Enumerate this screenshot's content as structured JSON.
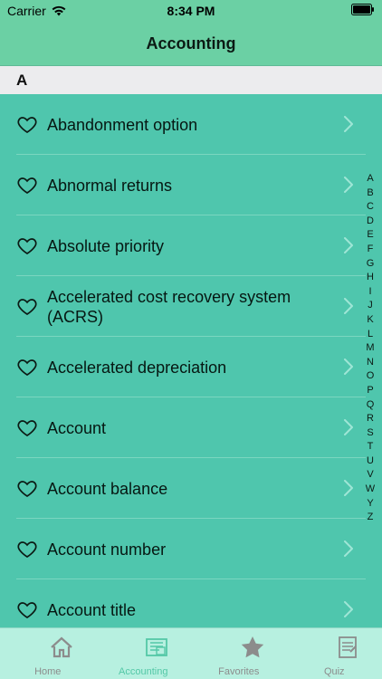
{
  "status": {
    "carrier": "Carrier",
    "time": "8:34 PM"
  },
  "nav": {
    "title": "Accounting"
  },
  "section": {
    "letter": "A"
  },
  "terms": [
    "Abandonment option",
    "Abnormal returns",
    "Absolute priority",
    "Accelerated cost recovery system (ACRS)",
    "Accelerated depreciation",
    "Account",
    "Account balance",
    "Account number",
    "Account title"
  ],
  "index_letters": [
    "A",
    "B",
    "C",
    "D",
    "E",
    "F",
    "G",
    "H",
    "I",
    "J",
    "K",
    "L",
    "M",
    "N",
    "O",
    "P",
    "Q",
    "R",
    "S",
    "T",
    "U",
    "V",
    "W",
    "Y",
    "Z"
  ],
  "tabs": [
    {
      "label": "Home",
      "icon": "home-icon"
    },
    {
      "label": "Accounting",
      "icon": "accounting-book-icon",
      "active": true
    },
    {
      "label": "Favorites",
      "icon": "star-icon"
    },
    {
      "label": "Quiz",
      "icon": "quiz-icon"
    }
  ],
  "colors": {
    "accent": "#54c8a7",
    "bg": "#4fc6ad",
    "nav": "#6bd0a4"
  }
}
